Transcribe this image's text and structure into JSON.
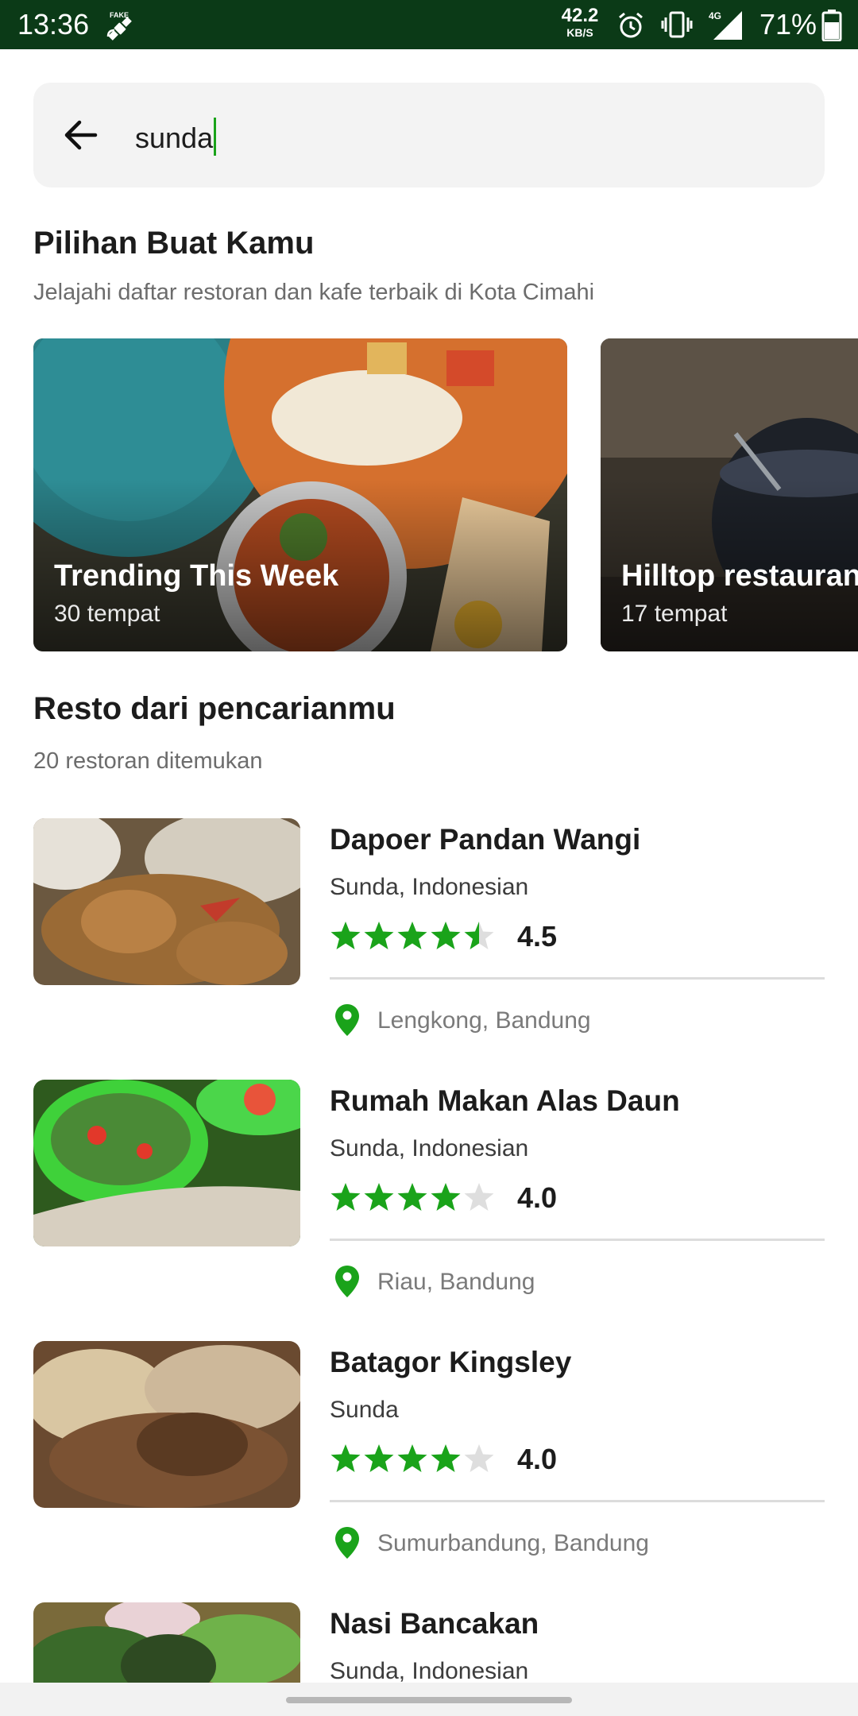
{
  "status_bar": {
    "time": "13:36",
    "speed_value": "42.2",
    "speed_unit": "KB/S",
    "network": "4G",
    "battery": "71%"
  },
  "search": {
    "value": "sunda",
    "back_icon": "arrow-back-icon"
  },
  "picks": {
    "title": "Pilihan Buat Kamu",
    "subtitle": "Jelajahi daftar restoran dan kafe terbaik di  Kota Cimahi",
    "collections": [
      {
        "title": "Trending This Week",
        "count": "30 tempat"
      },
      {
        "title": "Hilltop restaurants",
        "count": "17 tempat"
      }
    ]
  },
  "results": {
    "title": "Resto dari pencarianmu",
    "subtitle": "20 restoran ditemukan",
    "items": [
      {
        "name": "Dapoer Pandan Wangi",
        "cuisine": "Sunda, Indonesian",
        "rating": 4.5,
        "rating_label": "4.5",
        "location": "Lengkong, Bandung"
      },
      {
        "name": "Rumah Makan Alas Daun",
        "cuisine": "Sunda, Indonesian",
        "rating": 4.0,
        "rating_label": "4.0",
        "location": "Riau, Bandung"
      },
      {
        "name": "Batagor Kingsley",
        "cuisine": "Sunda",
        "rating": 4.0,
        "rating_label": "4.0",
        "location": "Sumurbandung, Bandung"
      },
      {
        "name": "Nasi Bancakan",
        "cuisine": "Sunda, Indonesian"
      }
    ]
  },
  "colors": {
    "accent_green": "#1aa31a",
    "status_bar": "#0b3a17",
    "star_empty": "#dedede"
  }
}
